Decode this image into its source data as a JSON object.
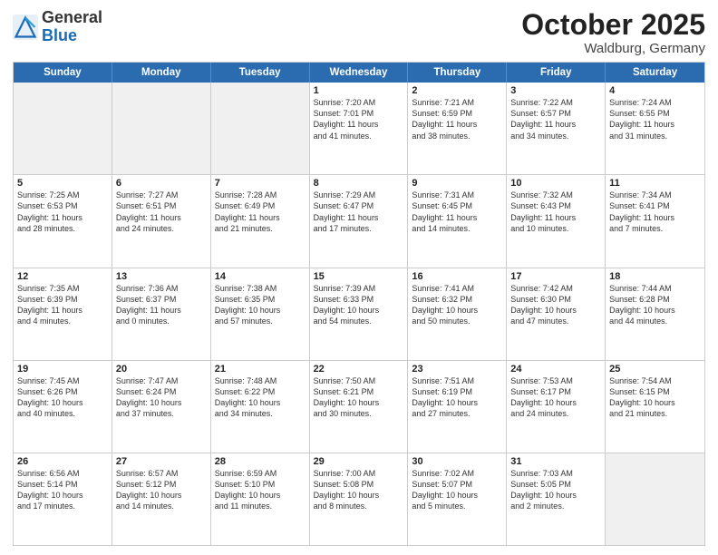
{
  "logo": {
    "general": "General",
    "blue": "Blue"
  },
  "title": "October 2025",
  "location": "Waldburg, Germany",
  "header_days": [
    "Sunday",
    "Monday",
    "Tuesday",
    "Wednesday",
    "Thursday",
    "Friday",
    "Saturday"
  ],
  "weeks": [
    [
      {
        "day": "",
        "info": "",
        "shaded": true
      },
      {
        "day": "",
        "info": "",
        "shaded": true
      },
      {
        "day": "",
        "info": "",
        "shaded": true
      },
      {
        "day": "1",
        "info": "Sunrise: 7:20 AM\nSunset: 7:01 PM\nDaylight: 11 hours\nand 41 minutes.",
        "shaded": false
      },
      {
        "day": "2",
        "info": "Sunrise: 7:21 AM\nSunset: 6:59 PM\nDaylight: 11 hours\nand 38 minutes.",
        "shaded": false
      },
      {
        "day": "3",
        "info": "Sunrise: 7:22 AM\nSunset: 6:57 PM\nDaylight: 11 hours\nand 34 minutes.",
        "shaded": false
      },
      {
        "day": "4",
        "info": "Sunrise: 7:24 AM\nSunset: 6:55 PM\nDaylight: 11 hours\nand 31 minutes.",
        "shaded": false
      }
    ],
    [
      {
        "day": "5",
        "info": "Sunrise: 7:25 AM\nSunset: 6:53 PM\nDaylight: 11 hours\nand 28 minutes.",
        "shaded": false
      },
      {
        "day": "6",
        "info": "Sunrise: 7:27 AM\nSunset: 6:51 PM\nDaylight: 11 hours\nand 24 minutes.",
        "shaded": false
      },
      {
        "day": "7",
        "info": "Sunrise: 7:28 AM\nSunset: 6:49 PM\nDaylight: 11 hours\nand 21 minutes.",
        "shaded": false
      },
      {
        "day": "8",
        "info": "Sunrise: 7:29 AM\nSunset: 6:47 PM\nDaylight: 11 hours\nand 17 minutes.",
        "shaded": false
      },
      {
        "day": "9",
        "info": "Sunrise: 7:31 AM\nSunset: 6:45 PM\nDaylight: 11 hours\nand 14 minutes.",
        "shaded": false
      },
      {
        "day": "10",
        "info": "Sunrise: 7:32 AM\nSunset: 6:43 PM\nDaylight: 11 hours\nand 10 minutes.",
        "shaded": false
      },
      {
        "day": "11",
        "info": "Sunrise: 7:34 AM\nSunset: 6:41 PM\nDaylight: 11 hours\nand 7 minutes.",
        "shaded": false
      }
    ],
    [
      {
        "day": "12",
        "info": "Sunrise: 7:35 AM\nSunset: 6:39 PM\nDaylight: 11 hours\nand 4 minutes.",
        "shaded": false
      },
      {
        "day": "13",
        "info": "Sunrise: 7:36 AM\nSunset: 6:37 PM\nDaylight: 11 hours\nand 0 minutes.",
        "shaded": false
      },
      {
        "day": "14",
        "info": "Sunrise: 7:38 AM\nSunset: 6:35 PM\nDaylight: 10 hours\nand 57 minutes.",
        "shaded": false
      },
      {
        "day": "15",
        "info": "Sunrise: 7:39 AM\nSunset: 6:33 PM\nDaylight: 10 hours\nand 54 minutes.",
        "shaded": false
      },
      {
        "day": "16",
        "info": "Sunrise: 7:41 AM\nSunset: 6:32 PM\nDaylight: 10 hours\nand 50 minutes.",
        "shaded": false
      },
      {
        "day": "17",
        "info": "Sunrise: 7:42 AM\nSunset: 6:30 PM\nDaylight: 10 hours\nand 47 minutes.",
        "shaded": false
      },
      {
        "day": "18",
        "info": "Sunrise: 7:44 AM\nSunset: 6:28 PM\nDaylight: 10 hours\nand 44 minutes.",
        "shaded": false
      }
    ],
    [
      {
        "day": "19",
        "info": "Sunrise: 7:45 AM\nSunset: 6:26 PM\nDaylight: 10 hours\nand 40 minutes.",
        "shaded": false
      },
      {
        "day": "20",
        "info": "Sunrise: 7:47 AM\nSunset: 6:24 PM\nDaylight: 10 hours\nand 37 minutes.",
        "shaded": false
      },
      {
        "day": "21",
        "info": "Sunrise: 7:48 AM\nSunset: 6:22 PM\nDaylight: 10 hours\nand 34 minutes.",
        "shaded": false
      },
      {
        "day": "22",
        "info": "Sunrise: 7:50 AM\nSunset: 6:21 PM\nDaylight: 10 hours\nand 30 minutes.",
        "shaded": false
      },
      {
        "day": "23",
        "info": "Sunrise: 7:51 AM\nSunset: 6:19 PM\nDaylight: 10 hours\nand 27 minutes.",
        "shaded": false
      },
      {
        "day": "24",
        "info": "Sunrise: 7:53 AM\nSunset: 6:17 PM\nDaylight: 10 hours\nand 24 minutes.",
        "shaded": false
      },
      {
        "day": "25",
        "info": "Sunrise: 7:54 AM\nSunset: 6:15 PM\nDaylight: 10 hours\nand 21 minutes.",
        "shaded": false
      }
    ],
    [
      {
        "day": "26",
        "info": "Sunrise: 6:56 AM\nSunset: 5:14 PM\nDaylight: 10 hours\nand 17 minutes.",
        "shaded": false
      },
      {
        "day": "27",
        "info": "Sunrise: 6:57 AM\nSunset: 5:12 PM\nDaylight: 10 hours\nand 14 minutes.",
        "shaded": false
      },
      {
        "day": "28",
        "info": "Sunrise: 6:59 AM\nSunset: 5:10 PM\nDaylight: 10 hours\nand 11 minutes.",
        "shaded": false
      },
      {
        "day": "29",
        "info": "Sunrise: 7:00 AM\nSunset: 5:08 PM\nDaylight: 10 hours\nand 8 minutes.",
        "shaded": false
      },
      {
        "day": "30",
        "info": "Sunrise: 7:02 AM\nSunset: 5:07 PM\nDaylight: 10 hours\nand 5 minutes.",
        "shaded": false
      },
      {
        "day": "31",
        "info": "Sunrise: 7:03 AM\nSunset: 5:05 PM\nDaylight: 10 hours\nand 2 minutes.",
        "shaded": false
      },
      {
        "day": "",
        "info": "",
        "shaded": true
      }
    ]
  ]
}
